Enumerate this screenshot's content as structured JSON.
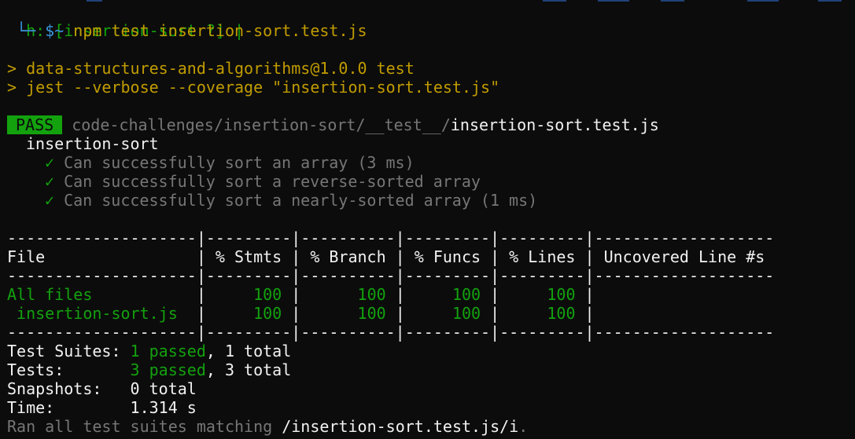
{
  "prompt": {
    "line1": "h: [insertion-sort ?] |",
    "branch_glyph": " └─ ",
    "symbol": "$~",
    "command": " npm test insertion-sort.test.js"
  },
  "npm_output": {
    "line1": "> data-structures-and-algorithms@1.0.0 test",
    "line2": "> jest --verbose --coverage \"insertion-sort.test.js\""
  },
  "result": {
    "badge": "PASS",
    "path_dim": "code-challenges/insertion-sort/__test__/",
    "path_file": "insertion-sort.test.js",
    "suite": "insertion-sort",
    "tests": [
      {
        "check": "✓",
        "text": "Can successfully sort an array (3 ms)"
      },
      {
        "check": "✓",
        "text": "Can successfully sort a reverse-sorted array"
      },
      {
        "check": "✓",
        "text": "Can successfully sort a nearly-sorted array (1 ms)"
      }
    ]
  },
  "coverage": {
    "separator": "--------------------|---------|----------|---------|---------|-------------------",
    "header": "File                | % Stmts | % Branch | % Funcs | % Lines | Uncovered Line #s ",
    "rows": [
      {
        "file": "All files          ",
        "stmts": "100",
        "branch": "100",
        "funcs": "100",
        "lines": "100"
      },
      {
        "file": " insertion-sort.js ",
        "stmts": "100",
        "branch": "100",
        "funcs": "100",
        "lines": "100"
      }
    ]
  },
  "summary": {
    "suites_label": "Test Suites: ",
    "suites_passed": "1 passed",
    "suites_total": ", 1 total",
    "tests_label": "Tests:       ",
    "tests_passed": "3 passed",
    "tests_total": ", 3 total",
    "snapshots_label": "Snapshots:   ",
    "snapshots_value": "0 total",
    "time_label": "Time:        ",
    "time_value": "1.314 s",
    "ran_dim": "Ran all test suites matching ",
    "ran_pattern": "/insertion-sort.test.js/i",
    "ran_end": "."
  },
  "colors": {
    "background": "#0c0c0c",
    "pass_green": "#13a10e",
    "command_amber": "#c19c00",
    "prompt_cyan": "#3a96dd",
    "dim_gray": "#767676"
  }
}
